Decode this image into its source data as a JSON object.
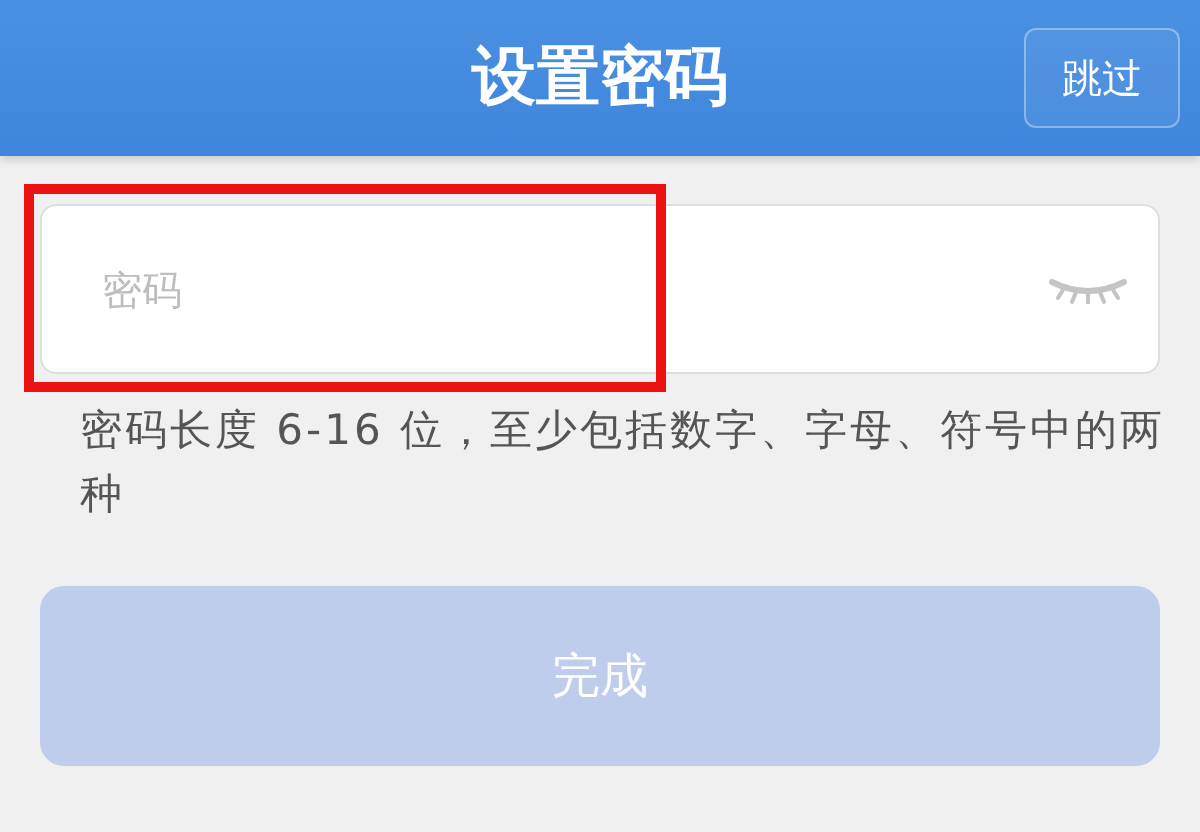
{
  "header": {
    "title": "设置密码",
    "skip_button": "跳过"
  },
  "password_field": {
    "placeholder": "密码"
  },
  "hint": "密码长度 6-16 位，至少包括数字、字母、符号中的两种",
  "done_button": {
    "label": "完成",
    "disabled": true
  }
}
